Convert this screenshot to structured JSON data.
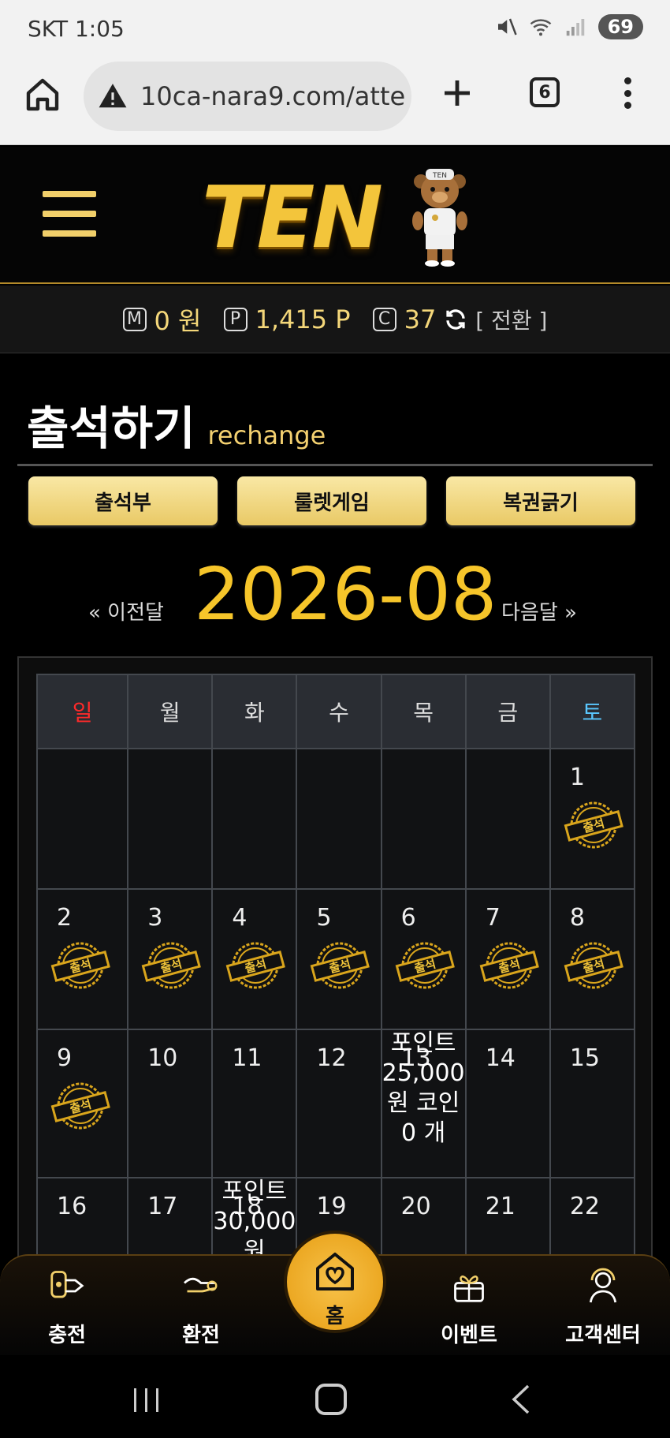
{
  "status_bar": {
    "time": "SKT 1:05",
    "battery": "69"
  },
  "browser": {
    "url": "10ca-nara9.com/atte",
    "tab_count": "6"
  },
  "site": {
    "logo_text": "TEN",
    "bear_tag": "TEN"
  },
  "balance": {
    "money_icon": "M",
    "money": "0 원",
    "point_icon": "P",
    "points": "1,415 P",
    "coin_icon": "C",
    "coins": "37",
    "switch_label": "[ 전환 ]"
  },
  "page": {
    "title": "출석하기",
    "subtitle": "rechange"
  },
  "tabs": [
    {
      "label": "출석부"
    },
    {
      "label": "룰렛게임"
    },
    {
      "label": "복권긁기"
    }
  ],
  "month_nav": {
    "prev": "« 이전달",
    "current": "2026-08",
    "next": "다음달 »"
  },
  "calendar": {
    "weekdays": [
      "일",
      "월",
      "화",
      "수",
      "목",
      "금",
      "토"
    ],
    "stamp_text": "출석",
    "weeks": [
      [
        {
          "day": "",
          "stamp": false
        },
        {
          "day": "",
          "stamp": false
        },
        {
          "day": "",
          "stamp": false
        },
        {
          "day": "",
          "stamp": false
        },
        {
          "day": "",
          "stamp": false
        },
        {
          "day": "",
          "stamp": false
        },
        {
          "day": "1",
          "stamp": true
        }
      ],
      [
        {
          "day": "2",
          "stamp": true
        },
        {
          "day": "3",
          "stamp": true
        },
        {
          "day": "4",
          "stamp": true
        },
        {
          "day": "5",
          "stamp": true
        },
        {
          "day": "6",
          "stamp": true
        },
        {
          "day": "7",
          "stamp": true
        },
        {
          "day": "8",
          "stamp": true
        }
      ],
      [
        {
          "day": "9",
          "stamp": true
        },
        {
          "day": "10",
          "stamp": false
        },
        {
          "day": "11",
          "stamp": false
        },
        {
          "day": "12",
          "stamp": false
        },
        {
          "day": "13",
          "stamp": false,
          "note": "포인트 25,000 원 코인0 개"
        },
        {
          "day": "14",
          "stamp": false
        },
        {
          "day": "15",
          "stamp": false
        }
      ],
      [
        {
          "day": "16",
          "stamp": false
        },
        {
          "day": "17",
          "stamp": false
        },
        {
          "day": "18",
          "stamp": false,
          "note": "포인트 30,000 원"
        },
        {
          "day": "19",
          "stamp": false
        },
        {
          "day": "20",
          "stamp": false
        },
        {
          "day": "21",
          "stamp": false
        },
        {
          "day": "22",
          "stamp": false
        }
      ]
    ]
  },
  "bottom_nav": {
    "charge": "충전",
    "exchange": "환전",
    "home": "홈",
    "event": "이벤트",
    "support": "고객센터"
  },
  "colors": {
    "accent": "#f6c52a",
    "sunday": "#ff2a2a",
    "saturday": "#5ac8ff"
  }
}
